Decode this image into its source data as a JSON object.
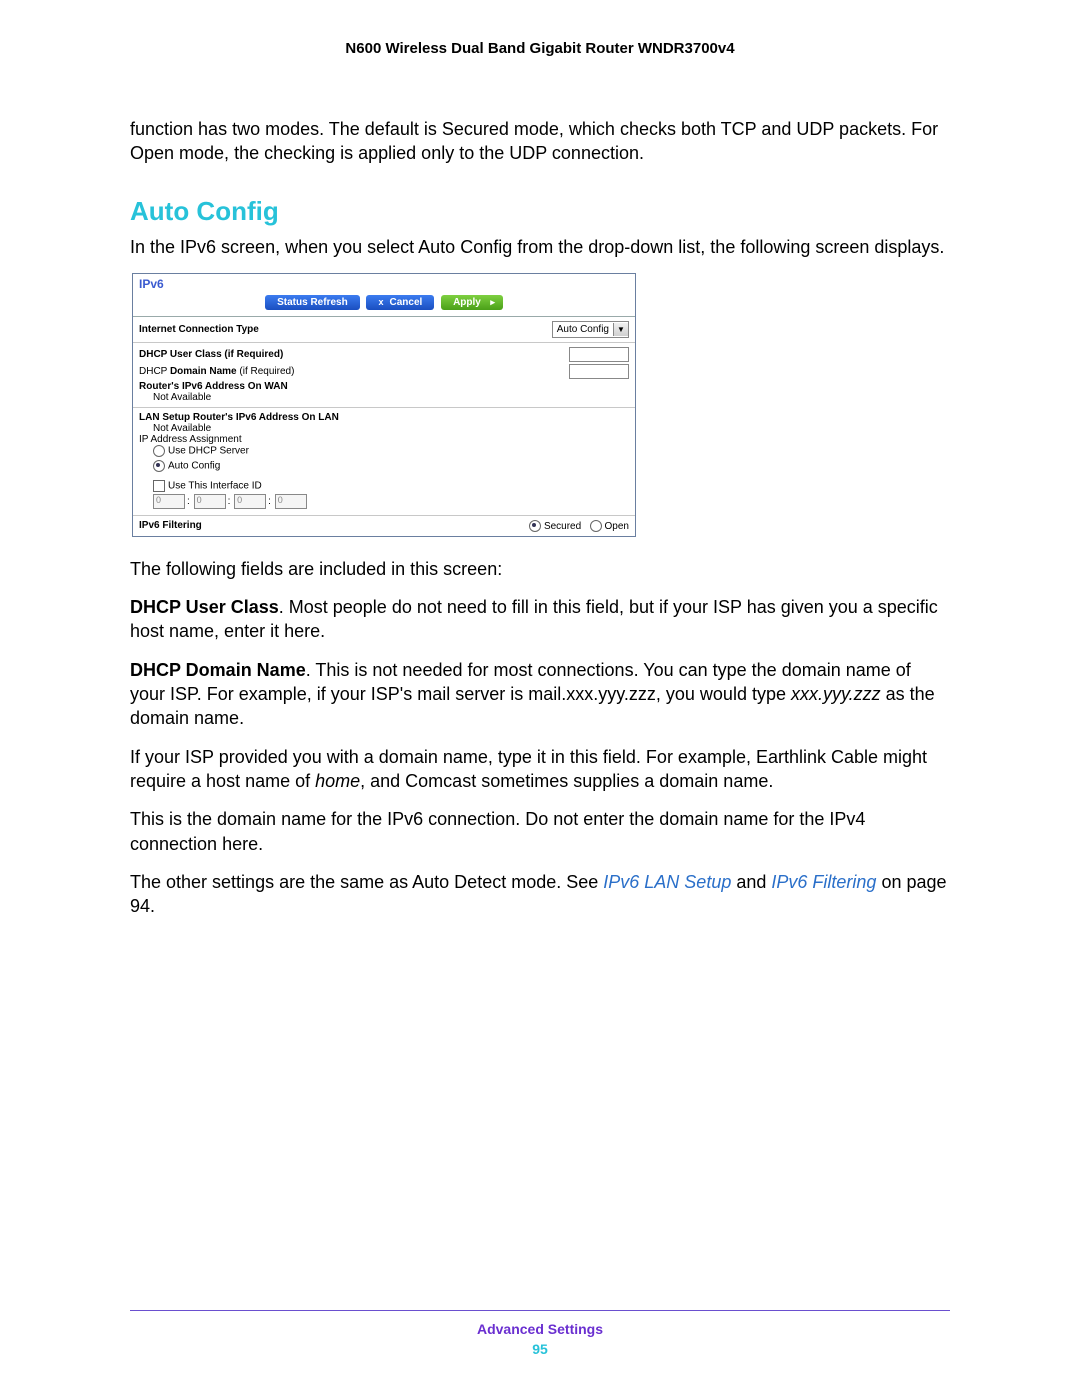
{
  "doc_title": "N600 Wireless Dual Band Gigabit Router WNDR3700v4",
  "intro_para": "function has two modes. The default is Secured mode, which checks both TCP and UDP packets. For Open mode, the checking is applied only to the UDP connection.",
  "section_heading": "Auto Config",
  "section_intro": "In the IPv6 screen, when you select Auto Config from the drop-down list, the following screen displays.",
  "shot": {
    "title": "IPv6",
    "buttons": {
      "refresh": "Status Refresh",
      "cancel": "Cancel",
      "apply": "Apply"
    },
    "conn_type_label": "Internet Connection Type",
    "conn_type_value": "Auto Config",
    "dhcp_user_class_label": "DHCP User Class (if Required)",
    "dhcp_domain_prefix": "DHCP ",
    "dhcp_domain_bold": "Domain Name",
    "dhcp_domain_suffix": " (if Required)",
    "wan_addr_label": "Router's IPv6 Address On WAN",
    "wan_addr_value": "Not Available",
    "lan_setup_label": "LAN Setup",
    "lan_addr_label": "Router's IPv6 Address On LAN",
    "lan_addr_value": "Not Available",
    "ip_assign_label": "IP Address Assignment",
    "ip_assign_opt1": "Use DHCP Server",
    "ip_assign_opt2": "Auto Config",
    "use_iface_label": "Use This Interface ID",
    "iface_vals": [
      "0",
      "0",
      "0",
      "0"
    ],
    "filtering_label": "IPv6 Filtering",
    "filtering_opt1": "Secured",
    "filtering_opt2": "Open"
  },
  "after_shot": "The following fields are included in this screen:",
  "p_userclass_bold": "DHCP User Class",
  "p_userclass_rest": ". Most people do not need to fill in this field, but if your ISP has given you a specific host name, enter it here.",
  "p_domain_bold": "DHCP Domain Name",
  "p_domain_mid": ". This is not needed for most connections. You can type the domain name of your ISP. For example, if your ISP's mail server is mail.xxx.yyy.zzz, you would type ",
  "p_domain_italic": "xxx.yyy.zzz",
  "p_domain_end": " as the domain name.",
  "p_isp_start": "If your ISP provided you with a domain name, type it in this field. For example, Earthlink Cable might require a host name of ",
  "p_isp_italic": "home",
  "p_isp_end": ", and Comcast sometimes supplies a domain name.",
  "p_ipv6only": "This is the domain name for the IPv6 connection. Do not enter the domain name for the IPv4 connection here.",
  "p_other_start": "The other settings are the same as Auto Detect mode. See ",
  "p_other_link1": "IPv6 LAN Setup",
  "p_other_mid": "  and ",
  "p_other_link2": "IPv6 Filtering",
  "p_other_end": " on page 94.",
  "footer_title": "Advanced Settings",
  "footer_page": "95"
}
